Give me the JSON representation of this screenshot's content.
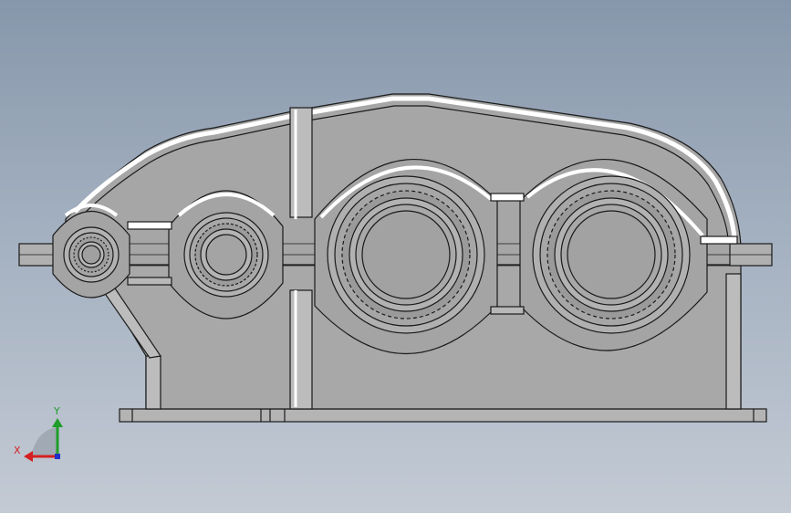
{
  "viewport": {
    "background_top": "#8797ab",
    "background_bottom": "#c3cad4",
    "model_fill": "#a9a9a9",
    "model_edge": "#1a1a1a",
    "highlight": "#ffffff"
  },
  "triad": {
    "x_label": "X",
    "y_label": "Y",
    "x_color": "#d42020",
    "y_color": "#1f9d2a",
    "z_color": "#2030c8"
  }
}
